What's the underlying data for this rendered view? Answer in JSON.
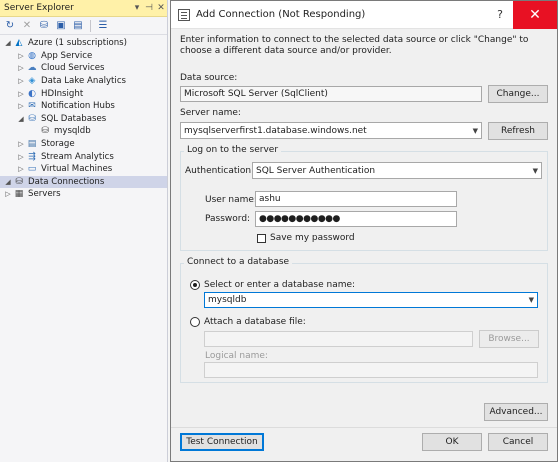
{
  "server_explorer": {
    "title": "Server Explorer",
    "title_buttons": [
      "▾",
      "⊣",
      "✕"
    ],
    "tree": [
      {
        "label": "Azure (1 subscriptions)",
        "indent": 0,
        "expanded": true,
        "icon": "azure-icon"
      },
      {
        "label": "App Service",
        "indent": 1,
        "icon": "globe-icon"
      },
      {
        "label": "Cloud Services",
        "indent": 1,
        "icon": "cloud-icon"
      },
      {
        "label": "Data Lake Analytics",
        "indent": 1,
        "icon": "data-lake-icon"
      },
      {
        "label": "HDInsight",
        "indent": 1,
        "icon": "hdinsight-icon"
      },
      {
        "label": "Notification Hubs",
        "indent": 1,
        "icon": "notification-hub-icon"
      },
      {
        "label": "SQL Databases",
        "indent": 1,
        "expanded": true,
        "icon": "sql-database-icon"
      },
      {
        "label": "mysqldb",
        "indent": 2,
        "icon": "database-icon"
      },
      {
        "label": "Storage",
        "indent": 1,
        "icon": "storage-icon"
      },
      {
        "label": "Stream Analytics",
        "indent": 1,
        "icon": "stream-analytics-icon"
      },
      {
        "label": "Virtual Machines",
        "indent": 1,
        "icon": "vm-icon"
      },
      {
        "label": "Data Connections",
        "indent": 0,
        "expanded": true,
        "selected": true,
        "icon": "data-connections-icon"
      },
      {
        "label": "Servers",
        "indent": 0,
        "icon": "servers-icon"
      }
    ]
  },
  "dialog": {
    "title": "Add Connection (Not Responding)",
    "help": "?",
    "close": "✕",
    "intro": "Enter information to connect to the selected data source or click \"Change\" to choose a different data source and/or provider.",
    "data_source_label": "Data source:",
    "data_source_value": "Microsoft SQL Server (SqlClient)",
    "change_button": "Change...",
    "server_name_label": "Server name:",
    "server_name_value": "mysqlserverfirst1.database.windows.net",
    "refresh_button": "Refresh",
    "logon_group": "Log on to the server",
    "auth_label": "Authentication:",
    "auth_value": "SQL Server Authentication",
    "username_label": "User name:",
    "username_value": "ashu",
    "password_label": "Password:",
    "password_value": "●●●●●●●●●●●",
    "save_password_label": "Save my password",
    "connect_group": "Connect to a database",
    "select_db_label": "Select or enter a database name:",
    "db_name_value": "mysqldb",
    "attach_label": "Attach a database file:",
    "browse_button": "Browse...",
    "logical_name_label": "Logical name:",
    "advanced_button": "Advanced...",
    "test_button": "Test Connection",
    "ok_button": "OK",
    "cancel_button": "Cancel"
  }
}
